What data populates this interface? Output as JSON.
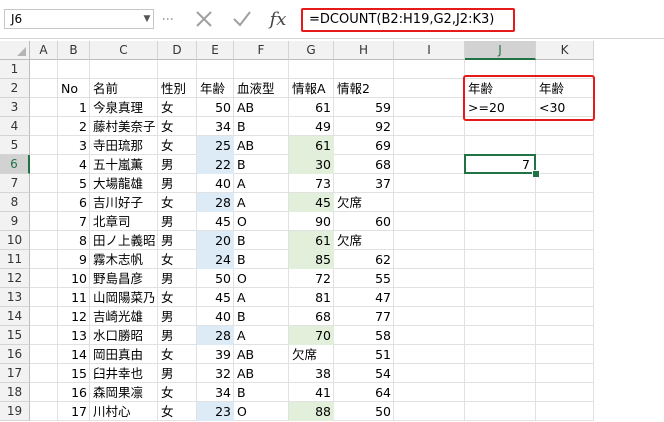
{
  "name_box": "J6",
  "formula": "=DCOUNT(B2:H19,G2,J2:K3)",
  "fx_label": "fx",
  "columns": [
    "A",
    "B",
    "C",
    "D",
    "E",
    "F",
    "G",
    "H",
    "I",
    "J",
    "K"
  ],
  "selected_column": "J",
  "selected_row": 6,
  "rows": [
    1,
    2,
    3,
    4,
    5,
    6,
    7,
    8,
    9,
    10,
    11,
    12,
    13,
    14,
    15,
    16,
    17,
    18,
    19
  ],
  "headers": {
    "no": "No",
    "name": "名前",
    "gender": "性別",
    "age": "年齢",
    "blood": "血液型",
    "infoA": "情報A",
    "info2": "情報2"
  },
  "records": [
    {
      "no": "1",
      "name": "今泉真理",
      "gender": "女",
      "age": "50",
      "blood": "AB",
      "infoA": "61",
      "info2": "59"
    },
    {
      "no": "2",
      "name": "藤村美奈子",
      "gender": "女",
      "age": "34",
      "blood": "B",
      "infoA": "49",
      "info2": "92"
    },
    {
      "no": "3",
      "name": "寺田琉那",
      "gender": "女",
      "age": "25",
      "blood": "AB",
      "infoA": "61",
      "info2": "69"
    },
    {
      "no": "4",
      "name": "五十嵐薫",
      "gender": "男",
      "age": "22",
      "blood": "B",
      "infoA": "30",
      "info2": "68"
    },
    {
      "no": "5",
      "name": "大場龍雄",
      "gender": "男",
      "age": "40",
      "blood": "A",
      "infoA": "73",
      "info2": "37"
    },
    {
      "no": "6",
      "name": "吉川好子",
      "gender": "女",
      "age": "28",
      "blood": "A",
      "infoA": "45",
      "info2": "欠席"
    },
    {
      "no": "7",
      "name": "北章司",
      "gender": "男",
      "age": "45",
      "blood": "O",
      "infoA": "90",
      "info2": "60"
    },
    {
      "no": "8",
      "name": "田ノ上義昭",
      "gender": "男",
      "age": "20",
      "blood": "B",
      "infoA": "61",
      "info2": "欠席"
    },
    {
      "no": "9",
      "name": "霧木志帆",
      "gender": "女",
      "age": "24",
      "blood": "B",
      "infoA": "85",
      "info2": "62"
    },
    {
      "no": "10",
      "name": "野島昌彦",
      "gender": "男",
      "age": "50",
      "blood": "O",
      "infoA": "72",
      "info2": "55"
    },
    {
      "no": "11",
      "name": "山岡陽菜乃",
      "gender": "女",
      "age": "45",
      "blood": "A",
      "infoA": "81",
      "info2": "47"
    },
    {
      "no": "12",
      "name": "吉崎光雄",
      "gender": "男",
      "age": "40",
      "blood": "B",
      "infoA": "68",
      "info2": "77"
    },
    {
      "no": "13",
      "name": "水口勝昭",
      "gender": "男",
      "age": "28",
      "blood": "A",
      "infoA": "70",
      "info2": "58"
    },
    {
      "no": "14",
      "name": "岡田真由",
      "gender": "女",
      "age": "39",
      "blood": "AB",
      "infoA": "欠席",
      "info2": "51"
    },
    {
      "no": "15",
      "name": "臼井幸也",
      "gender": "男",
      "age": "32",
      "blood": "AB",
      "infoA": "38",
      "info2": "54"
    },
    {
      "no": "16",
      "name": "森岡果凛",
      "gender": "女",
      "age": "34",
      "blood": "B",
      "infoA": "41",
      "info2": "64"
    },
    {
      "no": "17",
      "name": "川村心",
      "gender": "女",
      "age": "23",
      "blood": "O",
      "infoA": "88",
      "info2": "50"
    }
  ],
  "highlight_age_rows": [
    5,
    6,
    8,
    10,
    11,
    15,
    19
  ],
  "highlight_infoA_rows": [
    5,
    6,
    8,
    10,
    11,
    15,
    19
  ],
  "criteria": {
    "j2": "年齢",
    "k2": "年齢",
    "j3": ">=20",
    "k3": "<30"
  },
  "result": {
    "j6": "7"
  },
  "colors": {
    "accent_green": "#217346",
    "red": "#e51a1a",
    "blue_fill": "#ddebf7",
    "green_fill": "#e2efda"
  }
}
